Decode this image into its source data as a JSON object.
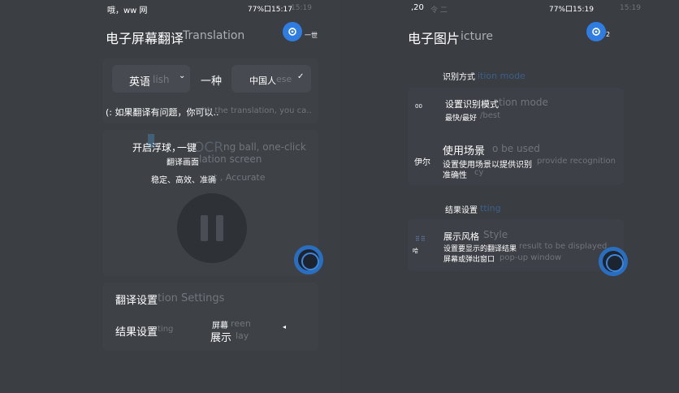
{
  "left": {
    "status_left": "哦，ww 网",
    "status_right": "77%口15:17",
    "status_time_ghost": "15:19",
    "title": "电子屏幕翻译",
    "title_ghost": "Translation",
    "title_corner": "一世",
    "source_lang": "英语",
    "source_lang_ghost": "lish",
    "middle_word": "一种",
    "target_lang": "中国人",
    "target_lang_ghost": "ese",
    "hint": "(: 如果翻译有问题，你可以..",
    "hint_ghost": "with the translation, you ca..",
    "float_line1": "开启浮球，",
    "float_line1b": "一键",
    "float_line1_ghost": "ng ball, one-click",
    "watermark": "OCR",
    "float_line2": "翻译画面",
    "float_line2_ghost": "lation screen",
    "float_line3": "稳定、高效、准确",
    "float_line3_ghost": "nt ,  Accurate",
    "settings_title": "翻译设置",
    "settings_title_ghost": "tion Settings",
    "result_label": "结果设置",
    "result_label_ghost": "ting",
    "result_value_line1": "屏幕",
    "result_value_line2": "展示",
    "result_value_ghost1": "reen",
    "result_value_ghost2": "lay"
  },
  "right": {
    "status_left": ",20",
    "status_right": "77%口15:19",
    "status_time_ghost": "15:19",
    "title": "电子图片",
    "title_ghost": "icture",
    "title_corner": "2",
    "section1": "识别方式",
    "section1_ghost": "ition mode",
    "mode_label": "设置识别模式",
    "mode_label_ghost": "tion mode",
    "mode_value": "最快/最好",
    "mode_value_ghost": "/best",
    "mode_icon": "00",
    "scene_label": "使用场景",
    "scene_label_ghost": "o be used",
    "scene_icon": "伊尔",
    "scene_desc1": "设置使用场景以提供识别",
    "scene_desc1_ghost": "provide recognition",
    "scene_desc2": "准确性",
    "scene_desc2_ghost": "cy",
    "section2": "结果设置",
    "section2_ghost": "tting",
    "style_label": "展示风格",
    "style_label_ghost": "Style",
    "style_icon": "哈",
    "style_desc1": "设置要显示的翻译结果",
    "style_desc1_ghost": "result to be displayed",
    "style_desc2": "屏幕或弹出窗口",
    "style_desc2_ghost": "pop-up window"
  },
  "colors": {
    "background": "#3a3d42",
    "accent": "#2f7de1",
    "float_ring": "#2a6fbf",
    "text": "#ffffff"
  }
}
